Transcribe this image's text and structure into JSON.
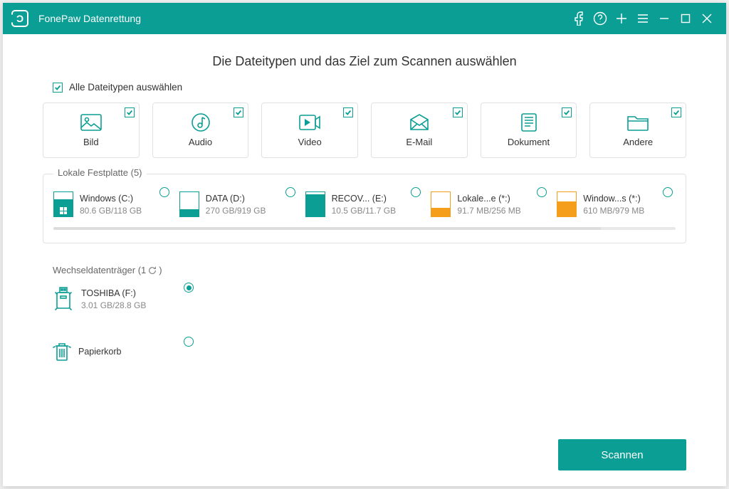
{
  "app": {
    "title": "FonePaw Datenrettung"
  },
  "header": {
    "heading": "Die Dateitypen und das Ziel zum Scannen auswählen",
    "select_all": "Alle Dateitypen auswählen"
  },
  "types": [
    {
      "id": "bild",
      "label": "Bild",
      "checked": true
    },
    {
      "id": "audio",
      "label": "Audio",
      "checked": true
    },
    {
      "id": "video",
      "label": "Video",
      "checked": true
    },
    {
      "id": "email",
      "label": "E-Mail",
      "checked": true
    },
    {
      "id": "dokument",
      "label": "Dokument",
      "checked": true
    },
    {
      "id": "andere",
      "label": "Andere",
      "checked": true
    }
  ],
  "local": {
    "legend": "Lokale Festplatte (5)",
    "drives": [
      {
        "name": "Windows (C:)",
        "size": "80.6 GB/118 GB",
        "fill": 70,
        "color": "teal",
        "win": true
      },
      {
        "name": "DATA (D:)",
        "size": "270 GB/919 GB",
        "fill": 30,
        "color": "teal",
        "win": false
      },
      {
        "name": "RECOV... (E:)",
        "size": "10.5 GB/11.7 GB",
        "fill": 90,
        "color": "teal",
        "win": false
      },
      {
        "name": "Lokale...e (*:)",
        "size": "91.7 MB/256 MB",
        "fill": 35,
        "color": "orange",
        "win": false
      },
      {
        "name": "Window...s (*:)",
        "size": "610 MB/979 MB",
        "fill": 62,
        "color": "orange",
        "win": false
      }
    ]
  },
  "removable": {
    "legend": "Wechseldatenträger (1",
    "item": {
      "name": "TOSHIBA (F:)",
      "size": "3.01 GB/28.8 GB",
      "selected": true
    }
  },
  "recycle": {
    "label": "Papierkorb",
    "selected": false
  },
  "scan": {
    "label": "Scannen"
  },
  "colors": {
    "teal": "#0b9e94",
    "orange": "#f59e1b"
  }
}
